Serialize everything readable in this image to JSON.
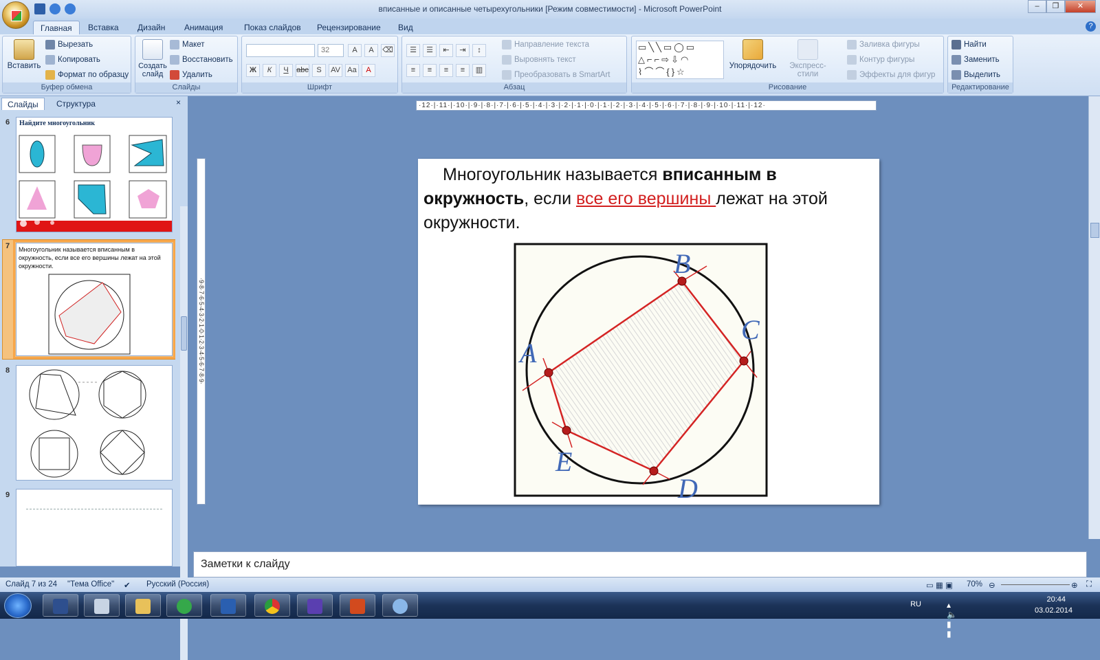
{
  "window": {
    "title": "вписанные и описанные четырехугольники [Режим совместимости] - Microsoft PowerPoint",
    "min": "–",
    "max": "❐",
    "close": "✕"
  },
  "tabs": [
    "Главная",
    "Вставка",
    "Дизайн",
    "Анимация",
    "Показ слайдов",
    "Рецензирование",
    "Вид"
  ],
  "ribbon": {
    "clipboard": {
      "paste": "Вставить",
      "cut": "Вырезать",
      "copy": "Копировать",
      "format_painter": "Формат по образцу",
      "label": "Буфер обмена"
    },
    "slides": {
      "new_slide": "Создать слайд",
      "layout": "Макет",
      "reset": "Восстановить",
      "delete": "Удалить",
      "label": "Слайды"
    },
    "font": {
      "size": "32",
      "label": "Шрифт"
    },
    "paragraph": {
      "text_direction": "Направление текста",
      "align_text": "Выровнять текст",
      "convert_smartart": "Преобразовать в SmartArt",
      "label": "Абзац"
    },
    "drawing": {
      "arrange": "Упорядочить",
      "quick_styles": "Экспресс-стили",
      "shape_fill": "Заливка фигуры",
      "shape_outline": "Контур фигуры",
      "shape_effects": "Эффекты для фигур",
      "label": "Рисование"
    },
    "editing": {
      "find": "Найти",
      "replace": "Заменить",
      "select": "Выделить",
      "label": "Редактирование"
    }
  },
  "panel": {
    "tab_slides": "Слайды",
    "tab_outline": "Структура",
    "close": "×"
  },
  "thumbs": {
    "s6": {
      "num": "6",
      "title": "Найдите многоугольник"
    },
    "s7": {
      "num": "7",
      "text": "Многоугольник называется вписанным в окружность, если все его вершины лежат на этой окружности."
    },
    "s8": {
      "num": "8"
    },
    "s9": {
      "num": "9"
    }
  },
  "ruler": {
    "h": "·12·|·11·|·10·|·9·|·8·|·7·|·6·|·5·|·4·|·3·|·2·|·1·|·0·|·1·|·2·|·3·|·4·|·5·|·6·|·7·|·8·|·9·|·10·|·11·|·12·",
    "v": "·9·8·7·6·5·4·3·2·1·0·1·2·3·4·5·6·7·8·9·"
  },
  "slide": {
    "text_a": "Многоугольник называется ",
    "text_b": "вписанным в окружность",
    "text_c": ", если ",
    "text_d": "все его вершины ",
    "text_e": "лежат на этой окружности.",
    "points": {
      "A": "A",
      "B": "B",
      "C": "C",
      "D": "D",
      "E": "E"
    }
  },
  "notes": "Заметки к слайду",
  "status": {
    "slide": "Слайд 7 из 24",
    "theme": "\"Тема Office\"",
    "lang": "Русский (Россия)",
    "zoom": "70%"
  },
  "tray": {
    "lang": "RU",
    "time": "20:44",
    "date": "03.02.2014"
  },
  "colors": {
    "accent": "#d21f1f",
    "selection": "#f7a64a",
    "point": "#b51c1c",
    "letters": "#4169b7"
  }
}
